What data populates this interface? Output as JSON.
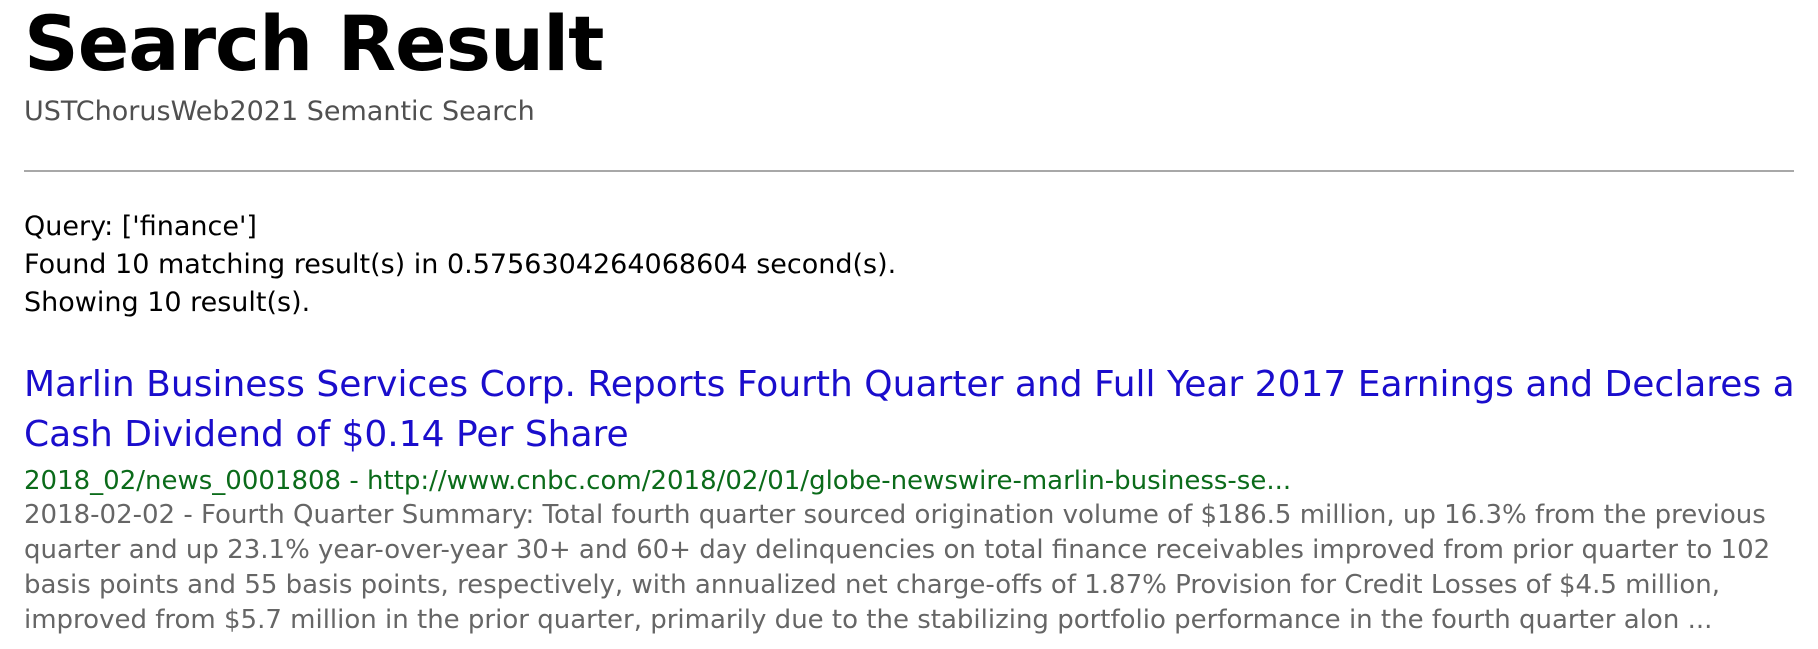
{
  "page": {
    "title": "Search Result",
    "subtitle": "USTChorusWeb2021 Semantic Search"
  },
  "query_info": {
    "query_line": "Query: ['finance']",
    "found_line": "Found 10 matching result(s) in 0.5756304264068604 second(s).",
    "showing_line": "Showing 10 result(s)."
  },
  "results": [
    {
      "title": "Marlin Business Services Corp. Reports Fourth Quarter and Full Year 2017 Earnings and Declares a Cash Dividend of $0.14 Per Share",
      "url_line": "2018_02/news_0001808 - http://www.cnbc.com/2018/02/01/globe-newswire-marlin-business-se...",
      "snippet": "2018-02-02 - Fourth Quarter Summary: Total fourth quarter sourced origination volume of $186.5 million, up 16.3% from the previous quarter and up 23.1% year-over-year 30+ and 60+ day delinquencies on total finance receivables improved from prior quarter to 102 basis points and 55 basis points, respectively, with annualized net charge-offs of 1.87% Provision for Credit Losses of $4.5 million, improved from $5.7 million in the prior quarter, primarily due to the stabilizing portfolio performance in the fourth quarter alon ..."
    }
  ],
  "colors": {
    "link": "#1a0dcc",
    "url": "#0b6b1a",
    "snippet": "#666666",
    "subtitle": "#505050",
    "divider": "#a8a8a8"
  }
}
